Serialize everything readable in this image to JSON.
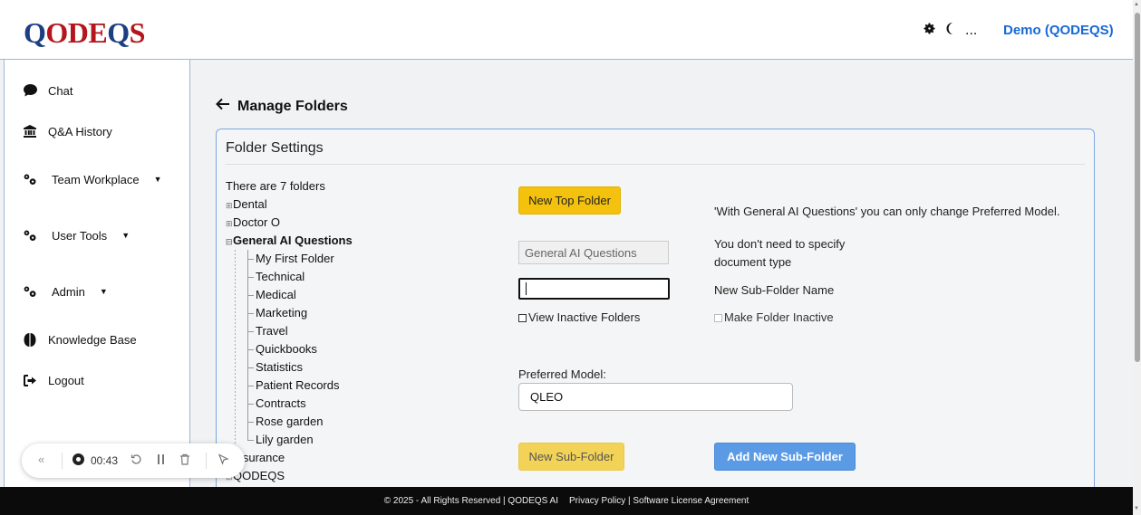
{
  "header": {
    "logo": "QODEQS",
    "settings_icon": "gear-icon",
    "theme_icon": "moon-icon",
    "more": "...",
    "user": "Demo (QODEQS)"
  },
  "sidebar": {
    "items": [
      {
        "label": "Chat",
        "icon": "chat-bubble-icon"
      },
      {
        "label": "Q&A History",
        "icon": "bank-icon"
      },
      {
        "label": "Team Workplace",
        "icon": "gears-icon"
      },
      {
        "label": "User Tools",
        "icon": "gears-icon"
      },
      {
        "label": "Admin",
        "icon": "gears-icon"
      },
      {
        "label": "Knowledge Base",
        "icon": "brain-icon"
      },
      {
        "label": "Logout",
        "icon": "logout-icon"
      }
    ]
  },
  "page": {
    "title": "Manage Folders",
    "card_title": "Folder Settings"
  },
  "tree": {
    "summary": "There are 7 folders",
    "top": [
      "Dental",
      "Doctor O",
      "General AI Questions"
    ],
    "children": [
      "My First Folder",
      "Technical",
      "Medical",
      "Marketing",
      "Travel",
      "Quickbooks",
      "Statistics",
      "Patient Records",
      "Contracts",
      "Rose garden",
      "Lily garden"
    ],
    "after": [
      "Insurance",
      "QODEQS"
    ]
  },
  "form": {
    "new_top_folder": "New Top Folder",
    "note_general": "'With General AI Questions' you can only change Preferred Model.",
    "selected_folder": "General AI Questions",
    "doc_type_note_1": "You don't need to specify",
    "doc_type_note_2": "document type",
    "subfolder_name_value": "",
    "subfolder_name_label": "New Sub-Folder Name",
    "view_inactive": "View Inactive Folders",
    "make_inactive": "Make Folder Inactive",
    "preferred_model_label": "Preferred Model:",
    "preferred_model_value": "QLEO",
    "new_subfolder": "New Sub-Folder",
    "add_subfolder": "Add New Sub-Folder"
  },
  "footer": {
    "copyright": "© 2025 - All Rights Reserved | QODEQS AI",
    "links": "Privacy Policy | Software License Agreement"
  },
  "recorder": {
    "time": "00:43"
  }
}
